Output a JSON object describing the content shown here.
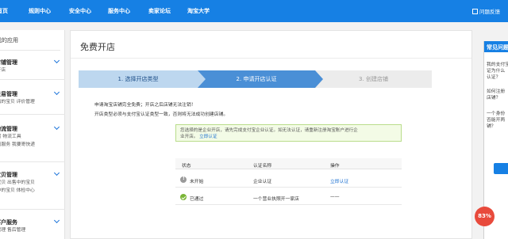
{
  "topbar": {
    "nav": [
      "首页",
      "规则中心",
      "安全中心",
      "服务中心",
      "卖家论坛",
      "淘宝大学"
    ],
    "feedback": "问题反馈"
  },
  "sidebar": {
    "title": "我的应用",
    "groups": [
      {
        "title": "店铺管理",
        "links": "我要开店"
      },
      {
        "title": "交易管理",
        "links": "已卖出的宝贝  评价管理"
      },
      {
        "title": "物流管理",
        "links1": "发货        物流工具",
        "links2": "物流服务    我要寄快递"
      },
      {
        "title": "宝贝管理",
        "links1": "发布宝贝    出售中的宝贝",
        "links2": "仓库中的宝贝  体检中心"
      },
      {
        "title": "客户服务",
        "links": "退款管理    售后管理"
      }
    ]
  },
  "main": {
    "title": "免费开店",
    "steps": [
      "1. 选择开店类型",
      "2. 申请开店认证",
      "3. 创建店铺"
    ],
    "notices": [
      "申请淘宝店铺完全免费；开店之后店铺无法注销！",
      "开店类型必须与支付宝认证类型一致，否则将无法成功创建店铺。"
    ],
    "infobox": {
      "text1": "您选择的是企业开店，请先完成支付宝企业认证。如无法认证，请重新注册淘宝账户进行企",
      "text2": "业开店。",
      "link": "立即认证"
    },
    "table": {
      "headers": [
        "状态",
        "认证名称",
        "操作"
      ],
      "rows": [
        {
          "status": "未开始",
          "name": "企业认证",
          "action": "立即认证"
        },
        {
          "status": "已通过",
          "name": "一个营业执照开一家店",
          "action": "——"
        }
      ]
    }
  },
  "faq": {
    "title": "常见问题",
    "q1_l1": "我的支付宝",
    "q1_l2": "证为什么",
    "q1_l3": "认证？",
    "q2_l1": "如何注册",
    "q2_l2": "店铺？",
    "q3_l1": "一个身份",
    "q3_l2": "否能开两",
    "q3_l3": "铺？"
  },
  "progress_badge": "83%"
}
